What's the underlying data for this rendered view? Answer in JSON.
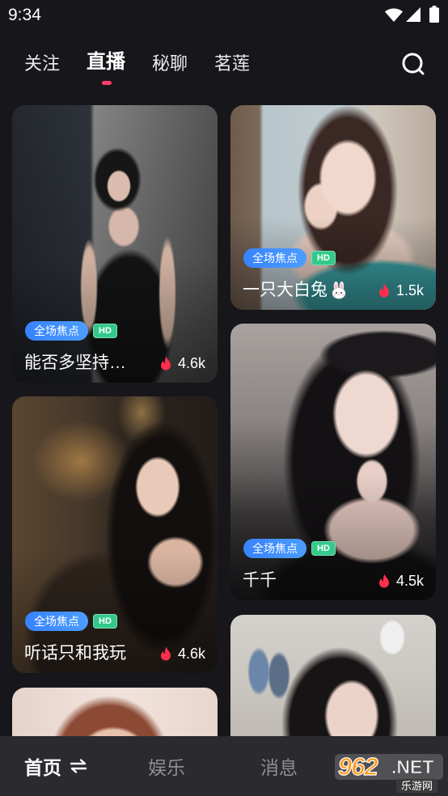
{
  "status_bar": {
    "time": "9:34",
    "icons": [
      "wifi-icon",
      "signal-icon",
      "battery-icon"
    ]
  },
  "top_tabs": [
    {
      "label": "关注",
      "active": false
    },
    {
      "label": "直播",
      "active": true
    },
    {
      "label": "秘聊",
      "active": false
    },
    {
      "label": "茗莲",
      "active": false
    }
  ],
  "search": {
    "icon": "search-icon"
  },
  "streams": [
    {
      "title": "能否多坚持…",
      "badge": "全场焦点",
      "quality": "HD",
      "viewers": "4.6k",
      "viewers_icon": "fire-icon"
    },
    {
      "title": "一只大白兔",
      "title_icon": "rabbit-face-icon",
      "badge": "全场焦点",
      "quality": "HD",
      "viewers": "1.5k",
      "viewers_icon": "fire-icon"
    },
    {
      "title": "千千",
      "badge": "全场焦点",
      "quality": "HD",
      "viewers": "4.5k",
      "viewers_icon": "fire-icon"
    },
    {
      "title": "听话只和我玩",
      "badge": "全场焦点",
      "quality": "HD",
      "viewers": "4.6k",
      "viewers_icon": "fire-icon"
    }
  ],
  "bottom_nav": [
    {
      "label": "首页",
      "active": true,
      "icon": "switch-icon"
    },
    {
      "label": "娱乐",
      "active": false
    },
    {
      "label": "消息",
      "active": false
    }
  ],
  "watermark": {
    "brand_number": "962",
    "brand_suffix": ".NET",
    "subtitle": "乐游网"
  },
  "colors": {
    "background": "#17161b",
    "tab_indicator": "#ff3d6a",
    "focus_badge": "#3b8cff",
    "hd_badge": "#33c98b",
    "fire": "#ff2e4d",
    "nav_bar": "#2b2a2f"
  }
}
